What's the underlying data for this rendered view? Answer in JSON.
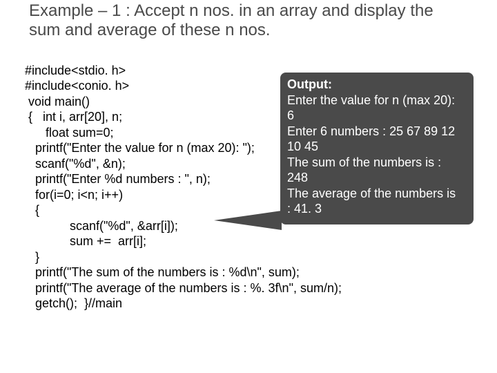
{
  "title": "Example – 1 : Accept n nos. in an array and display the sum and average of these n nos.",
  "code": {
    "l1": "#include<stdio. h>",
    "l2": "#include<conio. h>",
    "l3": " void main()",
    "l4": " {   int i, arr[20], n;",
    "l5": "      float sum=0;",
    "l6": "   printf(\"Enter the value for n (max 20): \");",
    "l7": "   scanf(\"%d\", &n);",
    "l8": "   printf(\"Enter %d numbers : \", n);",
    "l9": "   for(i=0; i<n; i++)",
    "l10": "   {",
    "l11": "             scanf(\"%d\", &arr[i]);",
    "l12": "             sum +=  arr[i];",
    "l13": "   }",
    "l14": "   printf(\"The sum of the numbers is : %d\\n\", sum);",
    "l15": "   printf(\"The average of the numbers is : %. 3f\\n\", sum/n);",
    "l16": "   getch();  }//main"
  },
  "output": {
    "label": "Output:",
    "line1": "Enter the value for n (max 20):",
    "line2": "6",
    "line3": "Enter 6 numbers : 25 67 89 12",
    "line4": "10 45",
    "line5": "The sum of the numbers is :",
    "line6": "248",
    "line7": "The average of the numbers is",
    "line8": ": 41. 3"
  }
}
